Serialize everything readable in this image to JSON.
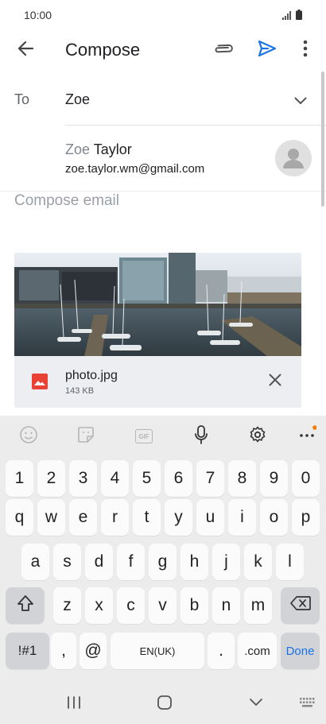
{
  "status_bar": {
    "time": "10:00",
    "signal_icon": "signal-icon",
    "battery_icon": "battery-icon"
  },
  "app_bar": {
    "title": "Compose",
    "back_icon": "back-arrow-icon",
    "attach_icon": "paperclip-icon",
    "send_icon": "send-icon",
    "more_icon": "more-vert-icon"
  },
  "to_field": {
    "label": "To",
    "value": "Zoe"
  },
  "suggestion": {
    "name_typed": "Zoe",
    "name_rest": " Taylor",
    "email": "zoe.taylor.wm@gmail.com"
  },
  "compose": {
    "placeholder": "Compose email"
  },
  "attachment": {
    "file_name": "photo.jpg",
    "file_size": "143 KB",
    "file_icon": "image-file-icon"
  },
  "keyboard": {
    "toolbar": [
      "emoji-icon",
      "sticker-icon",
      "gif-icon",
      "microphone-icon",
      "settings-icon",
      "more-horiz-icon"
    ],
    "gif_label": "GIF",
    "row_numbers": [
      "1",
      "2",
      "3",
      "4",
      "5",
      "6",
      "7",
      "8",
      "9",
      "0"
    ],
    "row_1": [
      "q",
      "w",
      "e",
      "r",
      "t",
      "y",
      "u",
      "i",
      "o",
      "p"
    ],
    "row_2": [
      "a",
      "s",
      "d",
      "f",
      "g",
      "h",
      "j",
      "k",
      "l"
    ],
    "row_3": [
      "z",
      "x",
      "c",
      "v",
      "b",
      "n",
      "m"
    ],
    "symbols_label": "!#1",
    "comma": ",",
    "at": "@",
    "space_label": "EN(UK)",
    "period": ".",
    "dotcom": ".com",
    "done_label": "Done"
  },
  "colors": {
    "accent": "#1a73e8",
    "file_icon_red": "#e94235",
    "notification_dot": "#f57c00"
  }
}
